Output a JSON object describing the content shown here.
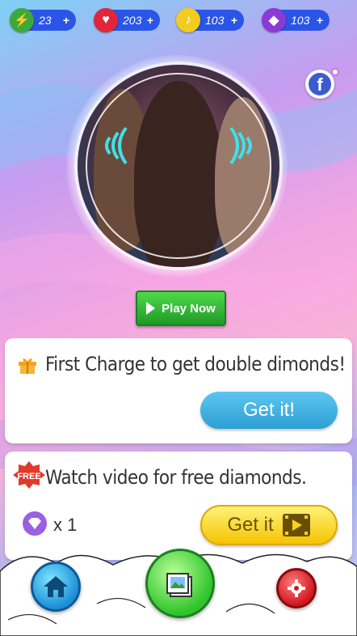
{
  "stats": {
    "energy": {
      "icon": "lightning-icon",
      "value": "23",
      "plus": "+"
    },
    "lives": {
      "icon": "heart-icon",
      "value": "203",
      "plus": "+"
    },
    "notes": {
      "icon": "music-note-icon",
      "value": "103",
      "plus": "+"
    },
    "diamonds": {
      "icon": "diamond-icon",
      "value": "103",
      "plus": "+"
    }
  },
  "play_button": {
    "label": "Play Now"
  },
  "offers": {
    "first_charge": {
      "title": "First Charge to get double dimonds!",
      "button": "Get it!"
    },
    "video": {
      "badge": "FREE",
      "title": "Watch video for free diamonds.",
      "reward_count": "x 1",
      "button": "Get it"
    }
  },
  "colors": {
    "stat_bg": "#2b55e6",
    "play_green": "#2fb52f",
    "blue_button": "#3aaee0",
    "yellow_button": "#f7d21c"
  }
}
